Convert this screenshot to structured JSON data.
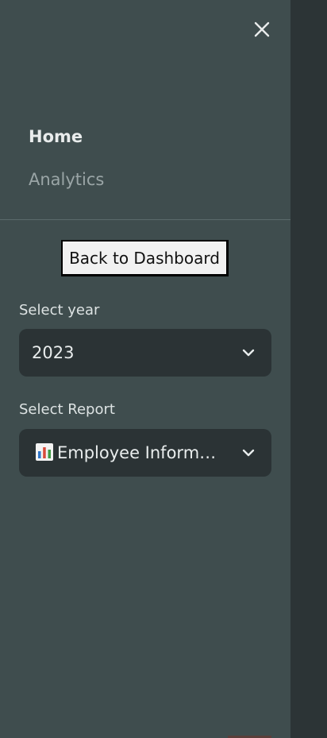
{
  "sidebar": {
    "close_icon": "close-icon",
    "nav": {
      "home_label": "Home",
      "analytics_label": "Analytics"
    },
    "back_button_label": "Back to Dashboard",
    "year_select": {
      "label": "Select year",
      "value": "2023"
    },
    "report_select": {
      "label": "Select Report",
      "icon": "bar-chart-icon",
      "value": "Employee Inform…"
    }
  },
  "colors": {
    "sidebar_bg": "#3f4d4e",
    "main_bg": "#2c3436",
    "select_bg": "#2b3335",
    "text_primary": "#e9ecec",
    "text_muted": "#9aa5a6"
  }
}
